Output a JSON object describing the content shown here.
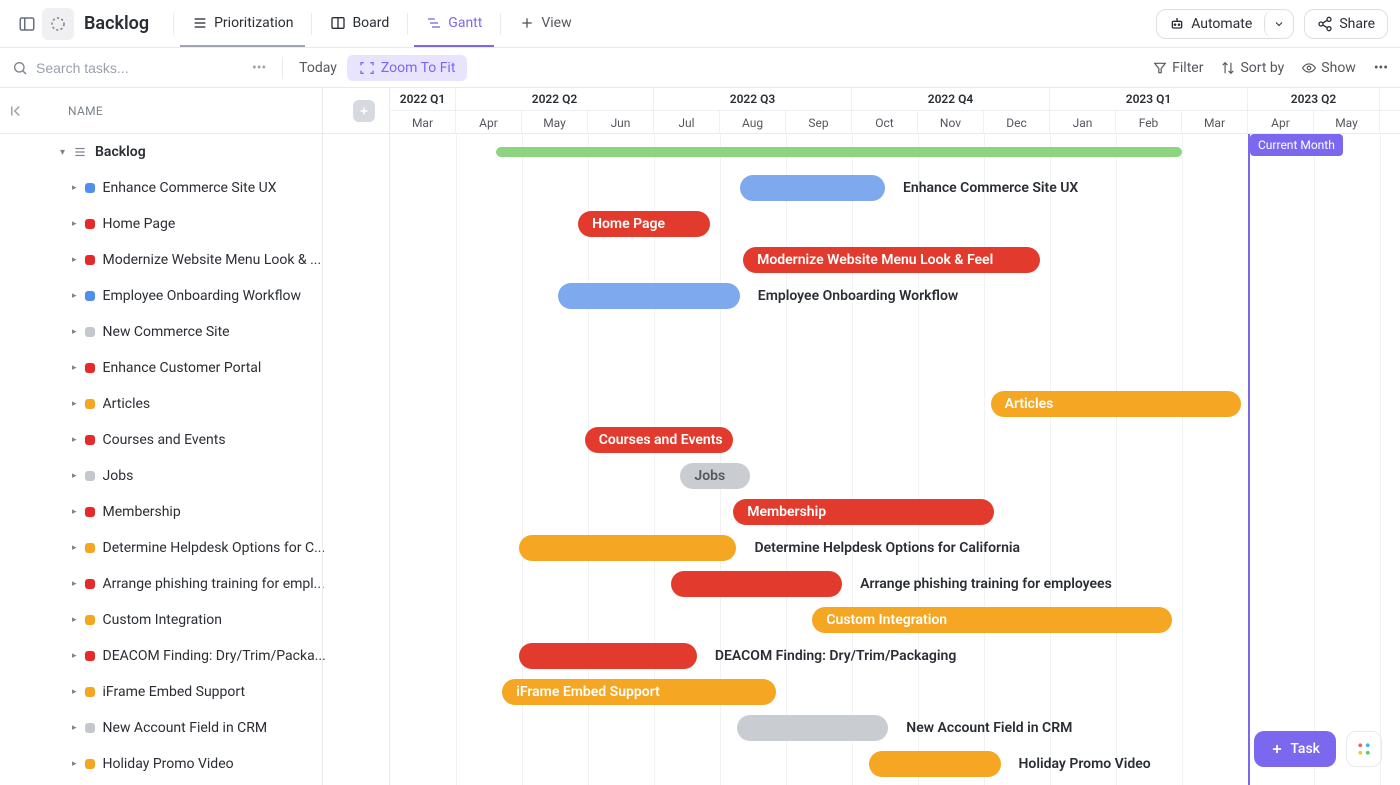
{
  "header": {
    "title": "Backlog",
    "views": [
      {
        "id": "prioritization",
        "label": "Prioritization",
        "icon": "list"
      },
      {
        "id": "board",
        "label": "Board",
        "icon": "board"
      },
      {
        "id": "gantt",
        "label": "Gantt",
        "icon": "gantt"
      },
      {
        "id": "addview",
        "label": "View",
        "icon": "plus"
      }
    ],
    "automate": "Automate",
    "share": "Share"
  },
  "toolbar": {
    "search_placeholder": "Search tasks...",
    "today": "Today",
    "zoom": "Zoom To Fit",
    "filter": "Filter",
    "sortby": "Sort by",
    "show": "Show"
  },
  "tree": {
    "header_label": "NAME",
    "group_label": "Backlog",
    "items": [
      {
        "label": "Enhance Commerce Site UX",
        "color": "#4f8ff0"
      },
      {
        "label": "Home Page",
        "color": "#e42a2a"
      },
      {
        "label": "Modernize Website Menu Look & ...",
        "color": "#e42a2a"
      },
      {
        "label": "Employee Onboarding Workflow",
        "color": "#4f8ff0"
      },
      {
        "label": "New Commerce Site",
        "color": "#c4c8ce"
      },
      {
        "label": "Enhance Customer Portal",
        "color": "#e42a2a"
      },
      {
        "label": "Articles",
        "color": "#f5a623"
      },
      {
        "label": "Courses and Events",
        "color": "#e42a2a"
      },
      {
        "label": "Jobs",
        "color": "#c4c8ce"
      },
      {
        "label": "Membership",
        "color": "#e42a2a"
      },
      {
        "label": "Determine Helpdesk Options for C...",
        "color": "#f5a623"
      },
      {
        "label": "Arrange phishing training for empl...",
        "color": "#e42a2a"
      },
      {
        "label": "Custom Integration",
        "color": "#f5a623"
      },
      {
        "label": "DEACOM Finding: Dry/Trim/Packa...",
        "color": "#e42a2a"
      },
      {
        "label": "iFrame Embed Support",
        "color": "#f5a623"
      },
      {
        "label": "New Account Field in CRM",
        "color": "#c4c8ce"
      },
      {
        "label": "Holiday Promo Video",
        "color": "#f5a623"
      }
    ]
  },
  "timeline": {
    "quarters": [
      {
        "label": "2022 Q1",
        "start": 0,
        "span": 1
      },
      {
        "label": "2022 Q2",
        "start": 1,
        "span": 3
      },
      {
        "label": "2022 Q3",
        "start": 4,
        "span": 3
      },
      {
        "label": "2022 Q4",
        "start": 7,
        "span": 3
      },
      {
        "label": "2023 Q1",
        "start": 10,
        "span": 3
      },
      {
        "label": "2023 Q2",
        "start": 13,
        "span": 2
      }
    ],
    "months": [
      "Mar",
      "Apr",
      "May",
      "Jun",
      "Jul",
      "Aug",
      "Sep",
      "Oct",
      "Nov",
      "Dec",
      "Jan",
      "Feb",
      "Mar",
      "Apr",
      "May"
    ],
    "month_width": 66,
    "left_offset": 0,
    "current_month_label": "Current Month",
    "current_month_index": 13.0,
    "bars": [
      {
        "row": 0,
        "start": 1.6,
        "end": 12.0,
        "color": "#8cd47e",
        "thin": true,
        "label": ""
      },
      {
        "row": 1,
        "start": 5.3,
        "end": 7.5,
        "color": "#7ea9ef",
        "label": "",
        "outside_label": "Enhance Commerce Site UX"
      },
      {
        "row": 2,
        "start": 2.85,
        "end": 4.85,
        "color": "#e23b2e",
        "label": "Home Page"
      },
      {
        "row": 3,
        "start": 5.35,
        "end": 9.85,
        "color": "#e23b2e",
        "label": "Modernize Website Menu Look & Feel"
      },
      {
        "row": 4,
        "start": 2.55,
        "end": 5.3,
        "color": "#7ea9ef",
        "label": "",
        "outside_label": "Employee Onboarding Workflow"
      },
      {
        "row": 7,
        "start": 9.1,
        "end": 12.9,
        "color": "#f5a623",
        "label": "Articles"
      },
      {
        "row": 8,
        "start": 2.95,
        "end": 5.2,
        "color": "#e23b2e",
        "label": "Courses and Events"
      },
      {
        "row": 9,
        "start": 4.4,
        "end": 5.45,
        "color": "#c9ccd1",
        "label": "Jobs",
        "text_color": "#54575d"
      },
      {
        "row": 10,
        "start": 5.2,
        "end": 9.15,
        "color": "#e23b2e",
        "label": "Membership"
      },
      {
        "row": 11,
        "start": 1.95,
        "end": 5.25,
        "color": "#f5a623",
        "label": "",
        "outside_label": "Determine Helpdesk Options for California"
      },
      {
        "row": 12,
        "start": 4.25,
        "end": 6.85,
        "color": "#e23b2e",
        "label": "",
        "outside_label": "Arrange phishing training for employees"
      },
      {
        "row": 13,
        "start": 6.4,
        "end": 11.85,
        "color": "#f5a623",
        "label": "Custom Integration"
      },
      {
        "row": 14,
        "start": 1.95,
        "end": 4.65,
        "color": "#e23b2e",
        "label": "",
        "outside_label": "DEACOM Finding: Dry/Trim/Packaging"
      },
      {
        "row": 15,
        "start": 1.7,
        "end": 5.85,
        "color": "#f5a623",
        "label": "iFrame Embed Support"
      },
      {
        "row": 16,
        "start": 5.25,
        "end": 7.55,
        "color": "#c9ccd1",
        "label": "",
        "outside_label": "New Account Field in CRM"
      },
      {
        "row": 17,
        "start": 7.25,
        "end": 9.25,
        "color": "#f5a623",
        "label": "",
        "outside_label": "Holiday Promo Video"
      }
    ]
  },
  "fab": {
    "task": "Task"
  }
}
